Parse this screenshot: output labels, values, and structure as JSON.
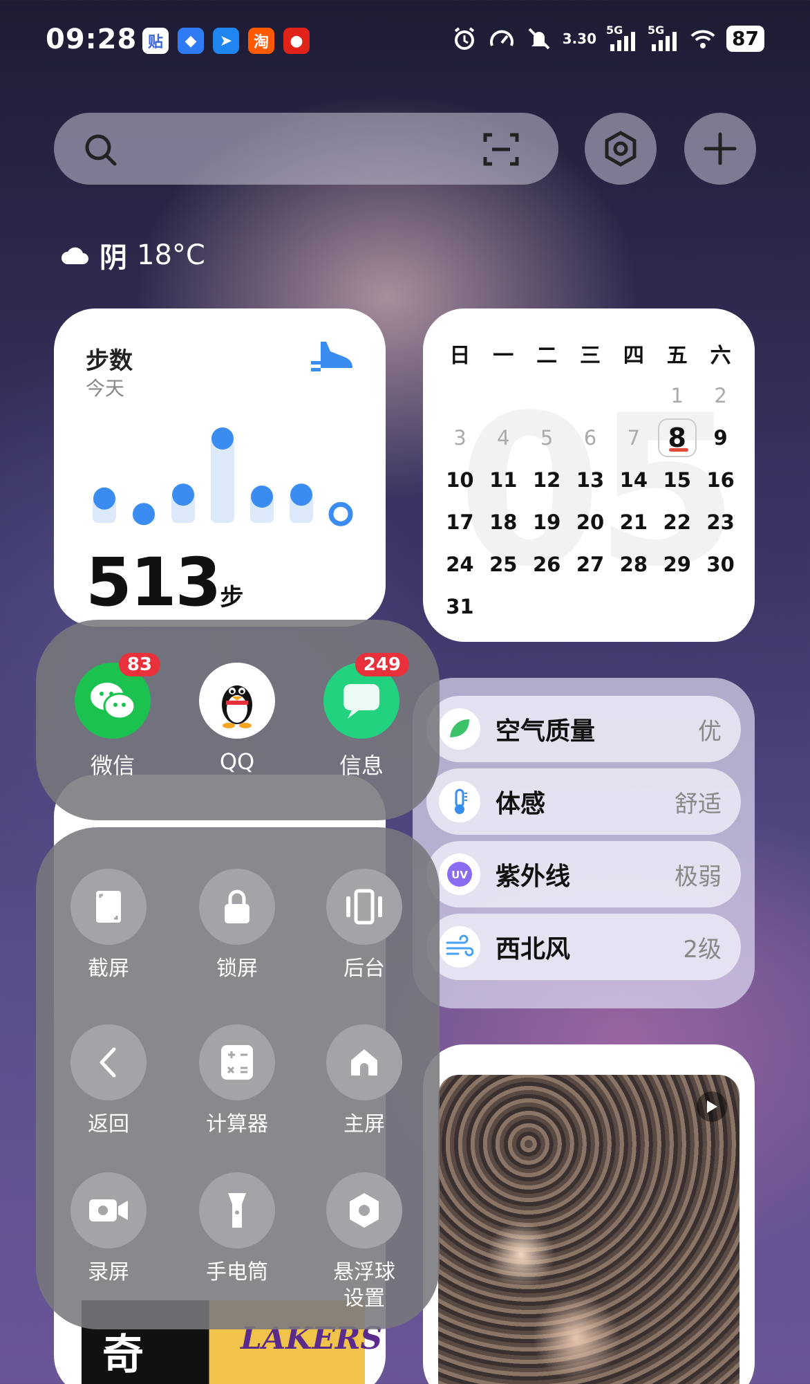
{
  "status_bar": {
    "time": "09:28",
    "net_speed_value": "3.30",
    "sim1": "5G",
    "sim2": "5G",
    "battery": "87"
  },
  "notification_icons": [
    {
      "name": "tieba-icon",
      "glyph": "贴",
      "color": "#ffffff",
      "fg": "#3b67d8"
    },
    {
      "name": "browser-icon",
      "glyph": "◆",
      "color": "#2f7bf5",
      "fg": "#ffffff"
    },
    {
      "name": "bird-app-icon",
      "glyph": "➤",
      "color": "#1f86f0",
      "fg": "#ffffff"
    },
    {
      "name": "taobao-icon",
      "glyph": "淘",
      "color": "#ff5a00",
      "fg": "#ffffff"
    },
    {
      "name": "jd-icon",
      "glyph": "●",
      "color": "#e2231a",
      "fg": "#ffffff"
    }
  ],
  "weather": {
    "condition": "阴",
    "temp": "18°C"
  },
  "steps": {
    "title": "步数",
    "subtitle": "今天",
    "count": "513",
    "unit": "步",
    "accent": "#3a8cf0",
    "bars": [
      0.28,
      0.12,
      0.32,
      0.9,
      0.3,
      0.32,
      0.12
    ]
  },
  "calendar": {
    "month_bg": "05",
    "weekdays": [
      "日",
      "一",
      "二",
      "三",
      "四",
      "五",
      "六"
    ],
    "today": "8",
    "days": [
      {
        "d": "",
        "dim": false
      },
      {
        "d": "",
        "dim": false
      },
      {
        "d": "",
        "dim": false
      },
      {
        "d": "",
        "dim": false
      },
      {
        "d": "",
        "dim": false
      },
      {
        "d": "1",
        "dim": true
      },
      {
        "d": "2",
        "dim": true
      },
      {
        "d": "3",
        "dim": true
      },
      {
        "d": "4",
        "dim": true
      },
      {
        "d": "5",
        "dim": true
      },
      {
        "d": "6",
        "dim": true
      },
      {
        "d": "7",
        "dim": true
      },
      {
        "d": "8",
        "dim": false
      },
      {
        "d": "9",
        "dim": false
      },
      {
        "d": "10",
        "dim": false
      },
      {
        "d": "11",
        "dim": false
      },
      {
        "d": "12",
        "dim": false
      },
      {
        "d": "13",
        "dim": false
      },
      {
        "d": "14",
        "dim": false
      },
      {
        "d": "15",
        "dim": false
      },
      {
        "d": "16",
        "dim": false
      },
      {
        "d": "17",
        "dim": false
      },
      {
        "d": "18",
        "dim": false
      },
      {
        "d": "19",
        "dim": false
      },
      {
        "d": "20",
        "dim": false
      },
      {
        "d": "21",
        "dim": false
      },
      {
        "d": "22",
        "dim": false
      },
      {
        "d": "23",
        "dim": false
      },
      {
        "d": "24",
        "dim": false
      },
      {
        "d": "25",
        "dim": false
      },
      {
        "d": "26",
        "dim": false
      },
      {
        "d": "27",
        "dim": false
      },
      {
        "d": "28",
        "dim": false
      },
      {
        "d": "29",
        "dim": false
      },
      {
        "d": "30",
        "dim": false
      },
      {
        "d": "31",
        "dim": false
      }
    ]
  },
  "environment": [
    {
      "label": "空气质量",
      "value": "优",
      "icon": "leaf-icon"
    },
    {
      "label": "体感",
      "value": "舒适",
      "icon": "thermometer-icon"
    },
    {
      "label": "紫外线",
      "value": "极弱",
      "icon": "uv-icon"
    },
    {
      "label": "西北风",
      "value": "2级",
      "icon": "wind-icon"
    }
  ],
  "apps": [
    {
      "label": "微信",
      "badge": "83",
      "icon": "wechat-icon",
      "color": "#1bc24f"
    },
    {
      "label": "QQ",
      "badge": "",
      "icon": "qq-penguin-icon",
      "color": "#ffffff"
    },
    {
      "label": "信息",
      "badge": "249",
      "icon": "message-icon",
      "color": "#22d27f"
    }
  ],
  "quick_actions": [
    {
      "label": "截屏",
      "icon": "screenshot-icon"
    },
    {
      "label": "锁屏",
      "icon": "lock-icon"
    },
    {
      "label": "后台",
      "icon": "recents-icon"
    },
    {
      "label": "返回",
      "icon": "back-icon"
    },
    {
      "label": "计算器",
      "icon": "calculator-icon"
    },
    {
      "label": "主屏",
      "icon": "home-icon"
    },
    {
      "label": "录屏",
      "icon": "screen-record-icon"
    },
    {
      "label": "手电筒",
      "icon": "flashlight-icon"
    },
    {
      "label": "悬浮球\n设置",
      "icon": "float-ball-settings-icon"
    }
  ],
  "peek": {
    "poster_char": "奇",
    "poster_team": "LAKERS"
  }
}
